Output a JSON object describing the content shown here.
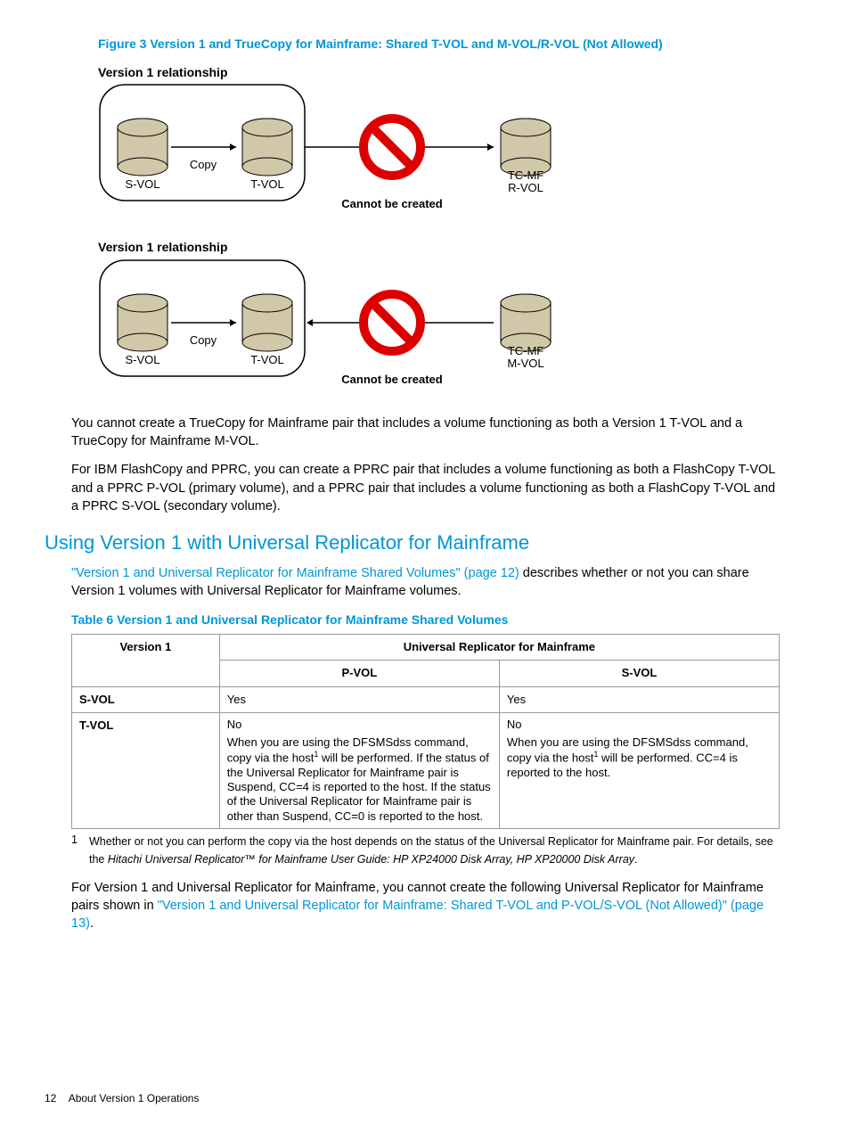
{
  "figure3": {
    "title": "Figure 3 Version 1 and TrueCopy for Mainframe: Shared T-VOL and M-VOL/R-VOL (Not Allowed)",
    "rel_label": "Version 1 relationship",
    "svol": "S-VOL",
    "tvol": "T-VOL",
    "copy": "Copy",
    "cannot": "Cannot be created",
    "tcmf": "TC-MF",
    "rvol": "R-VOL",
    "mvol": "M-VOL"
  },
  "para1": "You cannot create a TrueCopy for Mainframe pair that includes a volume functioning as both a Version 1 T-VOL and a TrueCopy for Mainframe M-VOL.",
  "para2": "For IBM FlashCopy and PPRC, you can create a PPRC pair that includes a volume functioning as both a FlashCopy T-VOL and a PPRC P-VOL (primary volume), and a PPRC pair that includes a volume functioning as both a FlashCopy T-VOL and a PPRC S-VOL (secondary volume).",
  "section_heading": "Using Version 1 with Universal Replicator for Mainframe",
  "para3_link": "\"Version 1 and Universal Replicator for Mainframe Shared Volumes\" (page 12)",
  "para3_rest": " describes whether or not you can share Version 1 volumes with Universal Replicator for Mainframe volumes.",
  "table6": {
    "title": "Table 6 Version 1 and Universal Replicator for Mainframe Shared Volumes",
    "h1": "Version 1",
    "h2": "Universal Replicator for Mainframe",
    "pvol": "P-VOL",
    "svol_h": "S-VOL",
    "row1_h": "S-VOL",
    "row1_c1": "Yes",
    "row1_c2": "Yes",
    "row2_h": "T-VOL",
    "row2_c1_a": "No",
    "row2_c1_b_pre": "When you are using the DFSMSdss command, copy via the host",
    "row2_c1_b_post": " will be performed. If the status of the Universal Replicator for Mainframe pair is Suspend, CC=4 is reported to the host. If the status of the Universal Replicator for Mainframe pair is other than Suspend, CC=0 is reported to the host.",
    "row2_c2_a": "No",
    "row2_c2_b_pre": "When you are using the DFSMSdss command, copy via the host",
    "row2_c2_b_post": " will be performed. CC=4 is reported to the host."
  },
  "footnote": {
    "num": "1",
    "text_a": "Whether or not you can perform the copy via the host depends on the status of the Universal Replicator for Mainframe pair. For details, see the ",
    "text_italic": "Hitachi Universal Replicator™ for Mainframe User Guide: HP XP24000 Disk Array, HP XP20000 Disk Array",
    "text_b": "."
  },
  "para4_a": "For Version 1 and Universal Replicator for Mainframe, you cannot create the following Universal Replicator for Mainframe pairs shown in ",
  "para4_link": "\"Version 1 and Universal Replicator for Mainframe: Shared T-VOL and P-VOL/S-VOL (Not Allowed)\" (page 13)",
  "para4_b": ".",
  "footer_page": "12",
  "footer_text": "About Version 1 Operations"
}
